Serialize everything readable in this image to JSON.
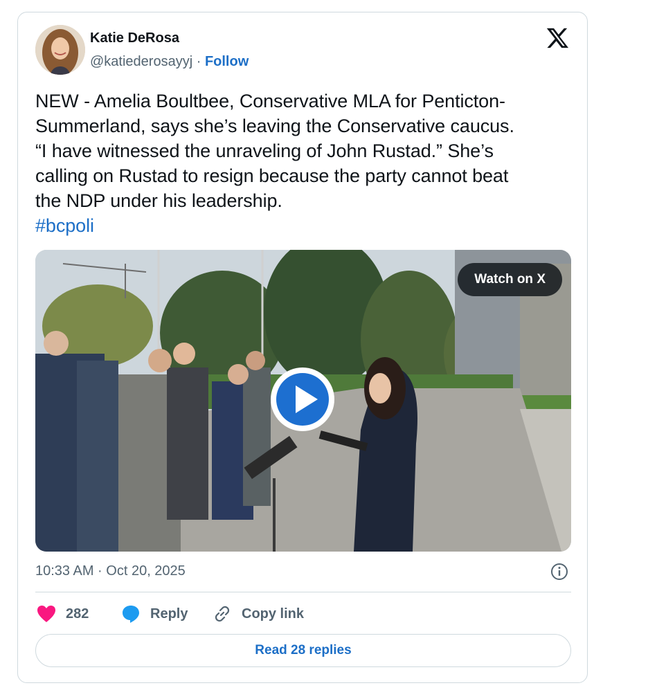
{
  "author": {
    "display_name": "Katie DeRosa",
    "handle": "@katiederosayyj",
    "separator": " · ",
    "follow_label": "Follow"
  },
  "tweet": {
    "lines": [
      "NEW - Amelia Boultbee, Conservative MLA for Penticton-",
      "Summerland, says she’s leaving the Conservative caucus.",
      "“I have witnessed the unraveling of John Rustad.” She’s",
      "calling on Rustad to resign because the party cannot beat",
      "the NDP under his leadership."
    ],
    "hashtag": "#bcpoli"
  },
  "media": {
    "watch_label": "Watch on X",
    "play_icon": "play-icon"
  },
  "meta": {
    "timestamp": "10:33 AM · Oct 20, 2025"
  },
  "actions": {
    "likes_count": "282",
    "reply_label": "Reply",
    "copy_link_label": "Copy link"
  },
  "footer": {
    "read_replies_label": "Read 28 replies"
  },
  "colors": {
    "link": "#1d6fc7",
    "like_heart": "#f91880",
    "reply_bubble": "#1d9bf0",
    "secondary_text": "#536471",
    "border": "#cfd9de"
  }
}
